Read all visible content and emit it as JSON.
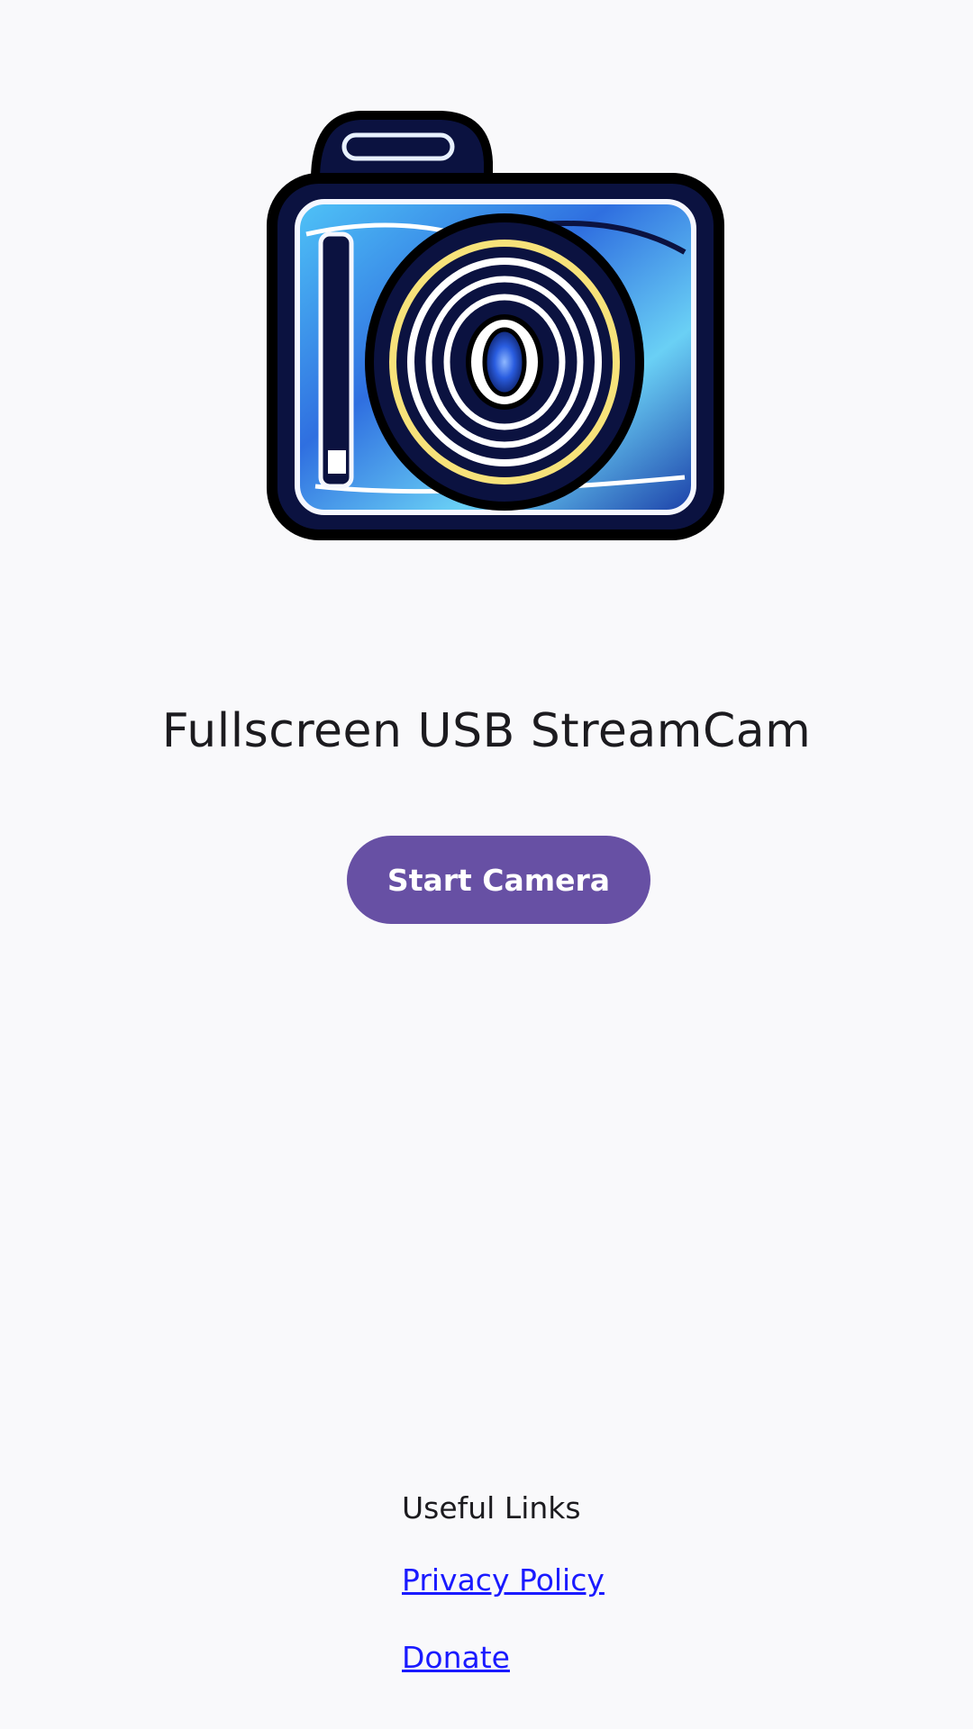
{
  "app": {
    "title": "Fullscreen USB StreamCam",
    "start_label": "Start Camera",
    "logo_icon": "camera-logo-icon"
  },
  "links": {
    "heading": "Useful Links",
    "items": [
      {
        "label": "Privacy Policy"
      },
      {
        "label": "Donate"
      }
    ]
  },
  "colors": {
    "background": "#f9f9fb",
    "accent": "#6750a4",
    "link": "#1a1aff"
  }
}
